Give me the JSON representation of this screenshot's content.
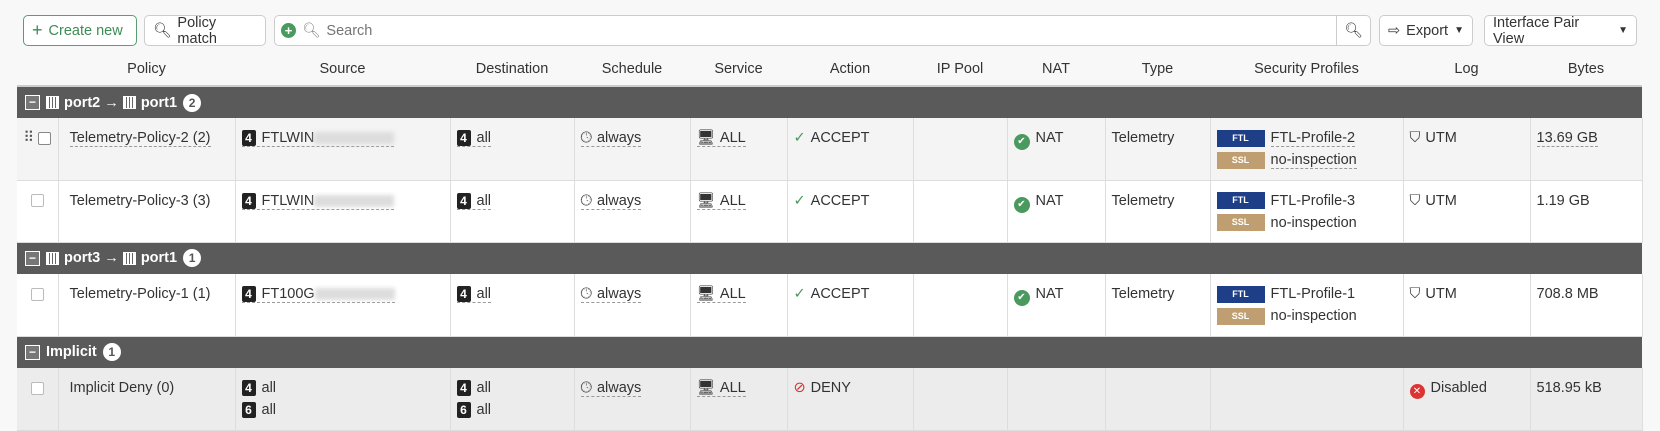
{
  "toolbar": {
    "create": "Create new",
    "policy_match": "Policy match",
    "search_placeholder": "Search",
    "export": "Export",
    "view": "Interface Pair View"
  },
  "columns": [
    "Policy",
    "Source",
    "Destination",
    "Schedule",
    "Service",
    "Action",
    "IP Pool",
    "NAT",
    "Type",
    "Security Profiles",
    "Log",
    "Bytes"
  ],
  "groups": [
    {
      "from": "port2",
      "to": "port1",
      "count": "2"
    },
    {
      "from": "port3",
      "to": "port1",
      "count": "1"
    },
    {
      "label": "Implicit",
      "count": "1"
    }
  ],
  "rows": [
    {
      "policy": "Telemetry-Policy-2 (2)",
      "source": "FTLWIN",
      "dest": "all",
      "schedule": "always",
      "service": "ALL",
      "action": "ACCEPT",
      "nat": "NAT",
      "type": "Telemetry",
      "profile": "FTL-Profile-2",
      "ssl": "no-inspection",
      "log": "UTM",
      "bytes": "13.69 GB"
    },
    {
      "policy": "Telemetry-Policy-3 (3)",
      "source": "FTLWIN",
      "dest": "all",
      "schedule": "always",
      "service": "ALL",
      "action": "ACCEPT",
      "nat": "NAT",
      "type": "Telemetry",
      "profile": "FTL-Profile-3",
      "ssl": "no-inspection",
      "log": "UTM",
      "bytes": "1.19 GB"
    },
    {
      "policy": "Telemetry-Policy-1 (1)",
      "source": "FT100G",
      "dest": "all",
      "schedule": "always",
      "service": "ALL",
      "action": "ACCEPT",
      "nat": "NAT",
      "type": "Telemetry",
      "profile": "FTL-Profile-1",
      "ssl": "no-inspection",
      "log": "UTM",
      "bytes": "708.8 MB"
    },
    {
      "policy": "Implicit Deny (0)",
      "source": "all",
      "source6": "all",
      "dest": "all",
      "dest6": "all",
      "schedule": "always",
      "service": "ALL",
      "action": "DENY",
      "log": "Disabled",
      "bytes": "518.95 kB"
    }
  ],
  "tags": {
    "ftl": "FTL",
    "ssl": "SSL",
    "v4": "4",
    "v6": "6"
  },
  "arrow": "→"
}
